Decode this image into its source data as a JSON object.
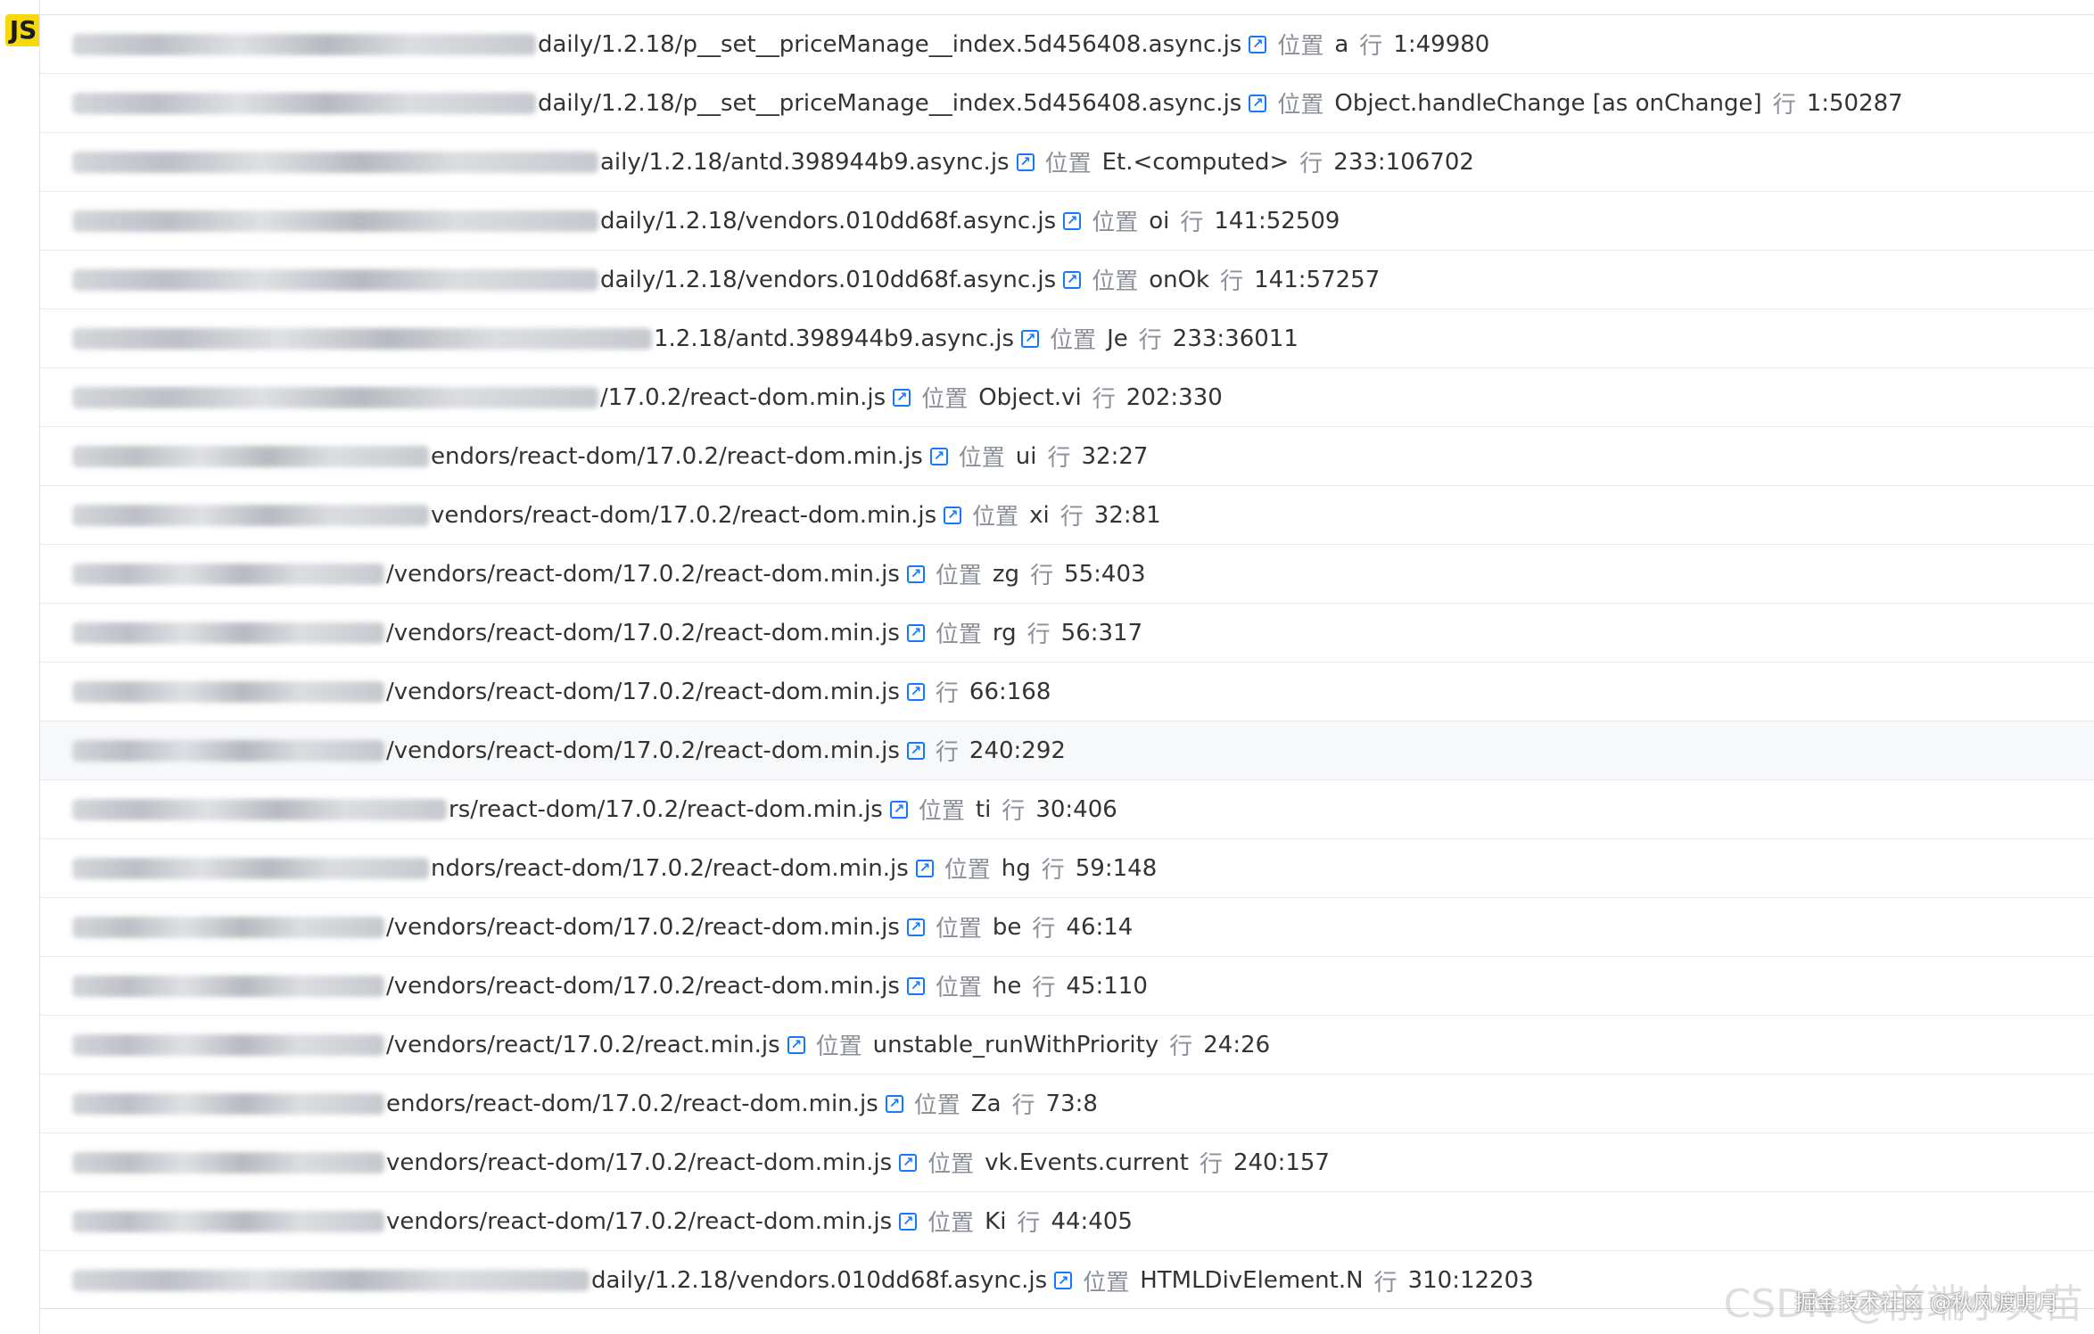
{
  "badge": "JS",
  "labels": {
    "location": "位置",
    "line": "行"
  },
  "rows": [
    {
      "blur": 520,
      "path": "daily/1.2.18/p__set__priceManage__index.5d456408.async.js",
      "fn": "a",
      "pos": "1:49980"
    },
    {
      "blur": 520,
      "path": "daily/1.2.18/p__set__priceManage__index.5d456408.async.js",
      "fn": "Object.handleChange [as onChange]",
      "pos": "1:50287"
    },
    {
      "blur": 590,
      "path": "aily/1.2.18/antd.398944b9.async.js",
      "fn": "Et.<computed>",
      "pos": "233:106702"
    },
    {
      "blur": 590,
      "path": "daily/1.2.18/vendors.010dd68f.async.js",
      "fn": "oi",
      "pos": "141:52509"
    },
    {
      "blur": 590,
      "path": "daily/1.2.18/vendors.010dd68f.async.js",
      "fn": "onOk",
      "pos": "141:57257"
    },
    {
      "blur": 650,
      "path": "1.2.18/antd.398944b9.async.js",
      "fn": "Je",
      "pos": "233:36011"
    },
    {
      "blur": 590,
      "path": "/17.0.2/react-dom.min.js",
      "fn": "Object.vi",
      "pos": "202:330"
    },
    {
      "blur": 400,
      "path": "endors/react-dom/17.0.2/react-dom.min.js",
      "fn": "ui",
      "pos": "32:27"
    },
    {
      "blur": 400,
      "path": "vendors/react-dom/17.0.2/react-dom.min.js",
      "fn": "xi",
      "pos": "32:81"
    },
    {
      "blur": 350,
      "path": "/vendors/react-dom/17.0.2/react-dom.min.js",
      "fn": "zg",
      "pos": "55:403"
    },
    {
      "blur": 350,
      "path": "/vendors/react-dom/17.0.2/react-dom.min.js",
      "fn": "rg",
      "pos": "56:317"
    },
    {
      "blur": 350,
      "path": "/vendors/react-dom/17.0.2/react-dom.min.js",
      "fn": "",
      "pos": "66:168"
    },
    {
      "blur": 350,
      "path": "/vendors/react-dom/17.0.2/react-dom.min.js",
      "fn": "",
      "pos": "240:292",
      "highlight": true
    },
    {
      "blur": 420,
      "path": "rs/react-dom/17.0.2/react-dom.min.js",
      "fn": "ti",
      "pos": "30:406"
    },
    {
      "blur": 400,
      "path": "ndors/react-dom/17.0.2/react-dom.min.js",
      "fn": "hg",
      "pos": "59:148"
    },
    {
      "blur": 350,
      "path": "/vendors/react-dom/17.0.2/react-dom.min.js",
      "fn": "be",
      "pos": "46:14"
    },
    {
      "blur": 350,
      "path": "/vendors/react-dom/17.0.2/react-dom.min.js",
      "fn": "he",
      "pos": "45:110"
    },
    {
      "blur": 350,
      "path": "/vendors/react/17.0.2/react.min.js",
      "fn": "unstable_runWithPriority",
      "pos": "24:26"
    },
    {
      "blur": 350,
      "path": "endors/react-dom/17.0.2/react-dom.min.js",
      "fn": "Za",
      "pos": "73:8"
    },
    {
      "blur": 350,
      "path": "vendors/react-dom/17.0.2/react-dom.min.js",
      "fn": "vk.Events.current",
      "pos": "240:157"
    },
    {
      "blur": 350,
      "path": "vendors/react-dom/17.0.2/react-dom.min.js",
      "fn": "Ki",
      "pos": "44:405"
    },
    {
      "blur": 580,
      "path": "daily/1.2.18/vendors.010dd68f.async.js",
      "fn": "HTMLDivElement.N",
      "pos": "310:12203"
    }
  ],
  "watermark": {
    "main": "CSDN @前端小火苗",
    "sub": "掘金技术社区 @秋风渡明月"
  },
  "colors": {
    "accent": "#1677ff",
    "badge_bg": "#f5d90a"
  }
}
